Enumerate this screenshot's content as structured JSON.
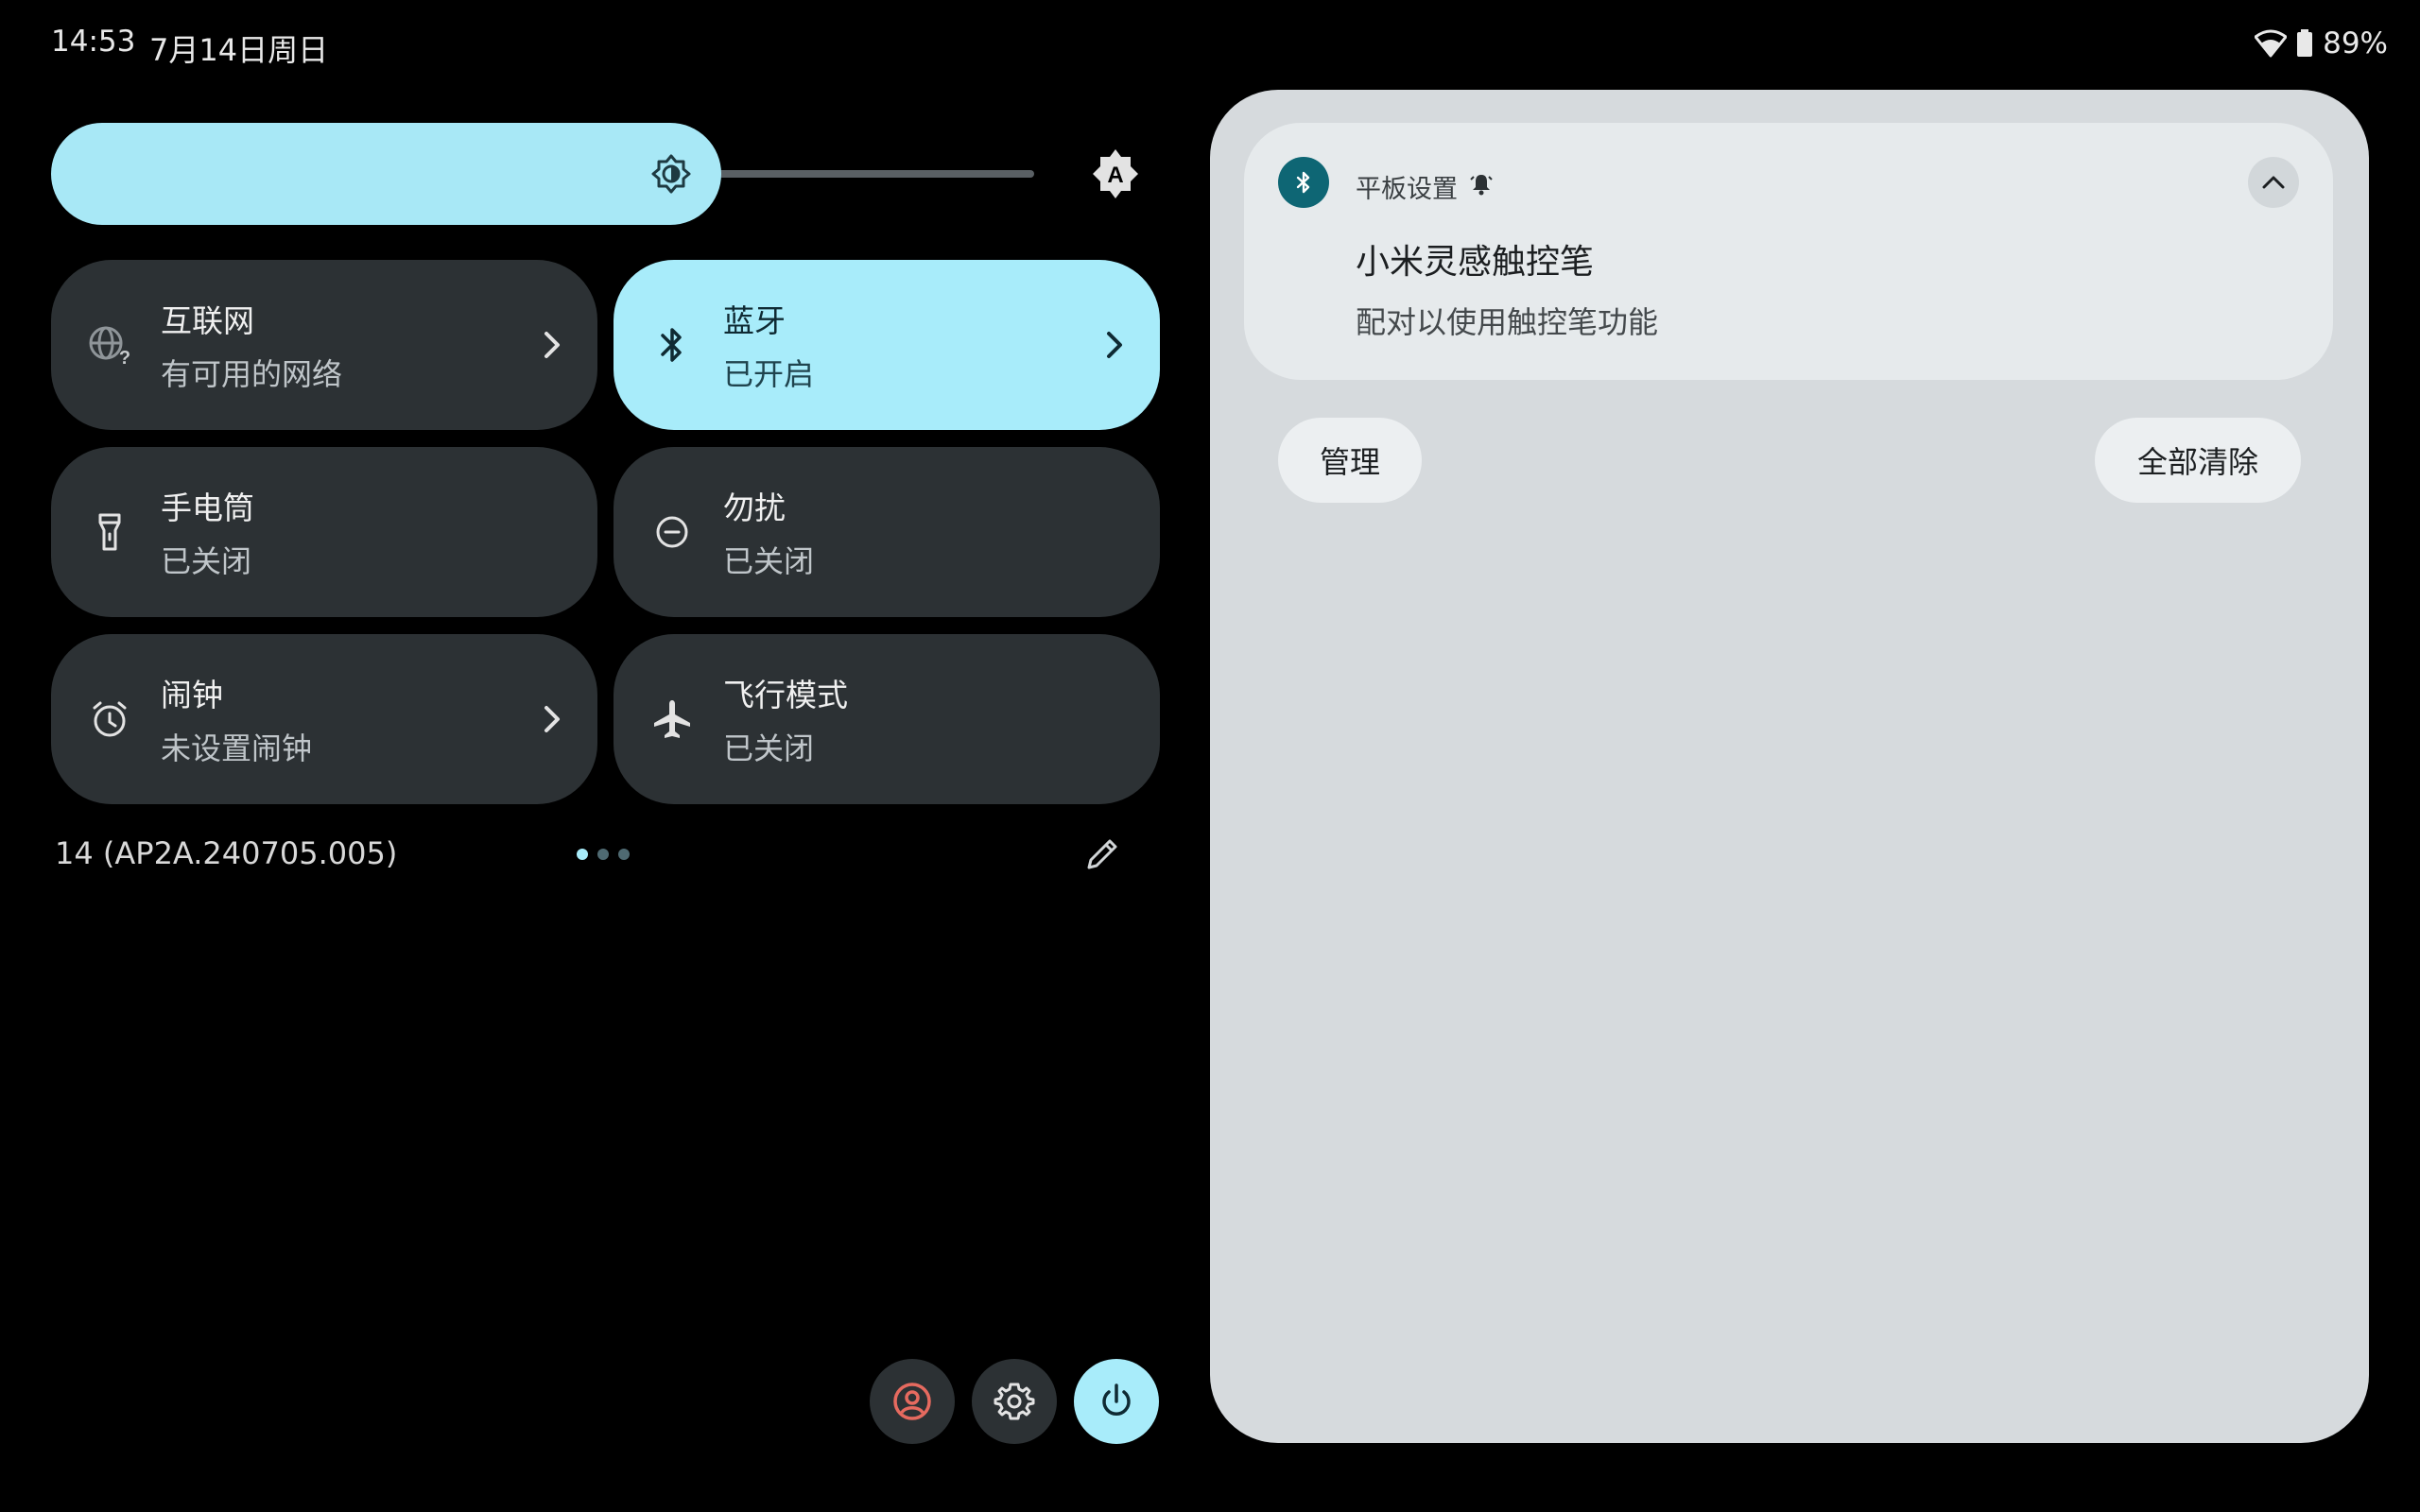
{
  "status_bar": {
    "time": "14:53",
    "date": "7月14日周日",
    "battery": "89%",
    "wifi_icon": "wifi-icon",
    "battery_icon": "battery-icon"
  },
  "brightness": {
    "level": 0.62,
    "icon": "brightness-icon",
    "auto_icon": "auto-brightness-icon"
  },
  "tiles": [
    {
      "title": "互联网",
      "subtitle": "有可用的网络",
      "icon": "globe-question-icon",
      "active": false,
      "chevron": true
    },
    {
      "title": "蓝牙",
      "subtitle": "已开启",
      "icon": "bluetooth-icon",
      "active": true,
      "chevron": true
    },
    {
      "title": "手电筒",
      "subtitle": "已关闭",
      "icon": "flashlight-icon",
      "active": false,
      "chevron": false
    },
    {
      "title": "勿扰",
      "subtitle": "已关闭",
      "icon": "do-not-disturb-icon",
      "active": false,
      "chevron": false
    },
    {
      "title": "闹钟",
      "subtitle": "未设置闹钟",
      "icon": "alarm-icon",
      "active": false,
      "chevron": true
    },
    {
      "title": "飞行模式",
      "subtitle": "已关闭",
      "icon": "airplane-icon",
      "active": false,
      "chevron": false
    }
  ],
  "footer": {
    "build": "14 (AP2A.240705.005)",
    "pages": 3,
    "current_page": 1
  },
  "notification": {
    "app_name": "平板设置",
    "title": "小米灵感触控笔",
    "body": "配对以使用触控笔功能"
  },
  "shade_actions": {
    "manage": "管理",
    "clear_all": "全部清除"
  },
  "colors": {
    "accent": "#a8ecfa",
    "tile_bg": "#2c3134",
    "shade_bg": "#d6dadd",
    "user_icon": "#e66a5f"
  }
}
